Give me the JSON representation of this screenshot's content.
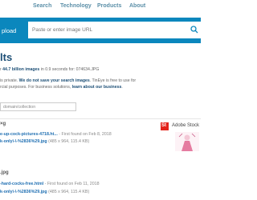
{
  "nav": {
    "items": [
      "Search",
      "Technology",
      "Products",
      "About"
    ]
  },
  "search_bar": {
    "upload_label": "pload",
    "url_placeholder": "Paste or enter image URL"
  },
  "results": {
    "title": "lts",
    "summary_prefix": "r ",
    "summary_count": "44.7 billion images",
    "summary_suffix": " in 0.9 seconds for: 074634.JPG",
    "privacy_line1_prefix": "is private. ",
    "privacy_link": "We do not save your search images",
    "privacy_line1_suffix": ". TinEye is free to use for",
    "privacy_line2_prefix": "rcial purposes. For business solutions, ",
    "business_link": "learn about our business",
    "privacy_line2_suffix": "."
  },
  "filter": {
    "placeholder": "domain/collection"
  },
  "result_items": [
    {
      "size_label": "×g",
      "page_link": "e-up-cock-pictures-4718.ht...",
      "page_found": " - First found on Feb 8, 2018",
      "image_link": "k-only\\-\\-%2836%29.jpg",
      "image_info": " (485 x 964, 115.4 KB)"
    },
    {
      "size_label": ".jpg",
      "page_link": "-hard-cocks-free.html",
      "page_found": " - First found on Feb 11, 2018",
      "image_link": "k-only\\-\\-%2836%29.jpg",
      "image_info": " (485 x 964, 115.4 KB)"
    }
  ],
  "stock": {
    "logo_text": "St",
    "label": "Adobe Stock"
  },
  "colors": {
    "accent_bar": "#0b87bd",
    "title": "#1d4f76",
    "link": "#1f6fb2"
  }
}
